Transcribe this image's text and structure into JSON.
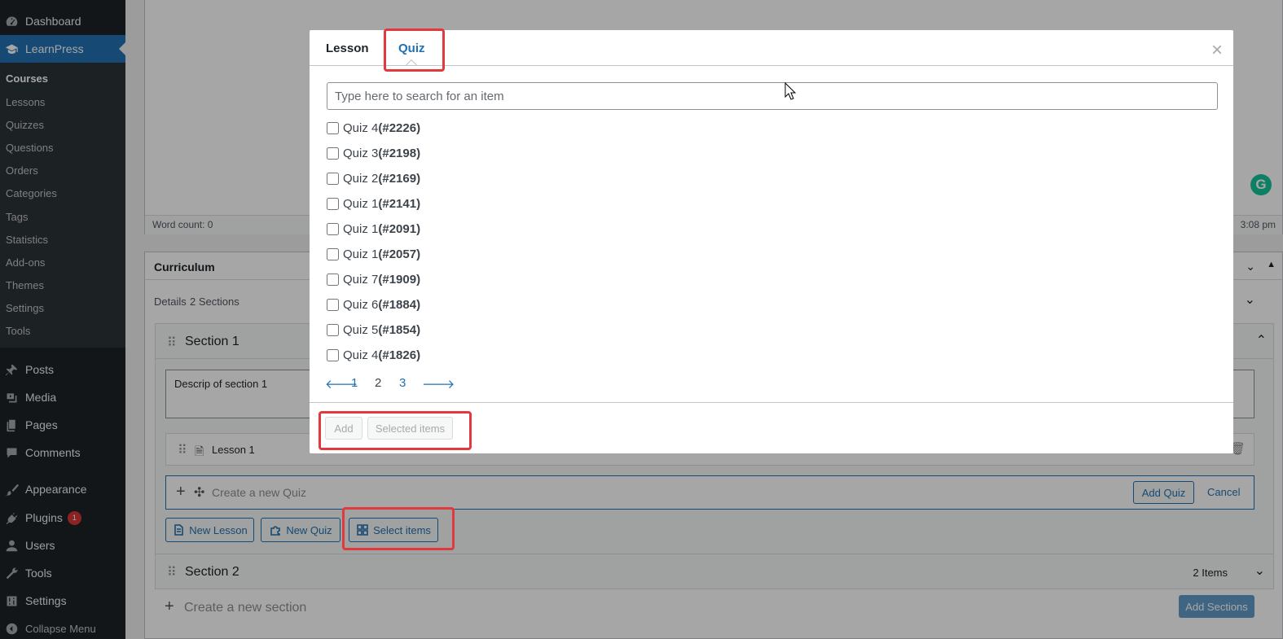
{
  "sidebar": {
    "dashboard": "Dashboard",
    "learnpress": "LearnPress",
    "submenu": [
      "Courses",
      "Lessons",
      "Quizzes",
      "Questions",
      "Orders",
      "Categories",
      "Tags",
      "Statistics",
      "Add-ons",
      "Themes",
      "Settings",
      "Tools"
    ],
    "posts": "Posts",
    "media": "Media",
    "pages": "Pages",
    "comments": "Comments",
    "appearance": "Appearance",
    "plugins": "Plugins",
    "plugins_badge": "1",
    "users": "Users",
    "tools": "Tools",
    "settings": "Settings",
    "collapse": "Collapse Menu"
  },
  "editor": {
    "word_count": "Word count: 0",
    "time": "3:08 pm"
  },
  "curriculum": {
    "title": "Curriculum",
    "details": "Details",
    "sections_count": "2 Sections",
    "section1": {
      "title": "Section 1",
      "description": "Descrip of section 1",
      "lesson": "Lesson 1",
      "create_quiz_placeholder": "Create a new Quiz",
      "add_quiz": "Add Quiz",
      "cancel": "Cancel",
      "new_lesson": "New Lesson",
      "new_quiz": "New Quiz",
      "select_items": "Select items"
    },
    "section2": {
      "title": "Section 2",
      "items": "2 Items"
    },
    "create_section_placeholder": "Create a new section",
    "add_sections": "Add Sections"
  },
  "modal": {
    "tabs": [
      "Lesson",
      "Quiz"
    ],
    "active_tab": "Quiz",
    "close": "×",
    "search_placeholder": "Type here to search for an item",
    "items": [
      {
        "name": "Quiz 4",
        "id": "(#2226)"
      },
      {
        "name": "Quiz 3",
        "id": "(#2198)"
      },
      {
        "name": "Quiz 2",
        "id": "(#2169)"
      },
      {
        "name": "Quiz 1",
        "id": "(#2141)"
      },
      {
        "name": "Quiz 1",
        "id": "(#2091)"
      },
      {
        "name": "Quiz 1",
        "id": "(#2057)"
      },
      {
        "name": "Quiz 7",
        "id": "(#1909)"
      },
      {
        "name": "Quiz 6",
        "id": "(#1884)"
      },
      {
        "name": "Quiz 5",
        "id": "(#1854)"
      },
      {
        "name": "Quiz 4",
        "id": "(#1826)"
      }
    ],
    "pages": [
      "1",
      "2",
      "3"
    ],
    "add": "Add",
    "selected_items": "Selected items"
  },
  "colors": {
    "accent": "#2271b1",
    "highlight": "#e0393e",
    "sidebar": "#1d2327"
  }
}
